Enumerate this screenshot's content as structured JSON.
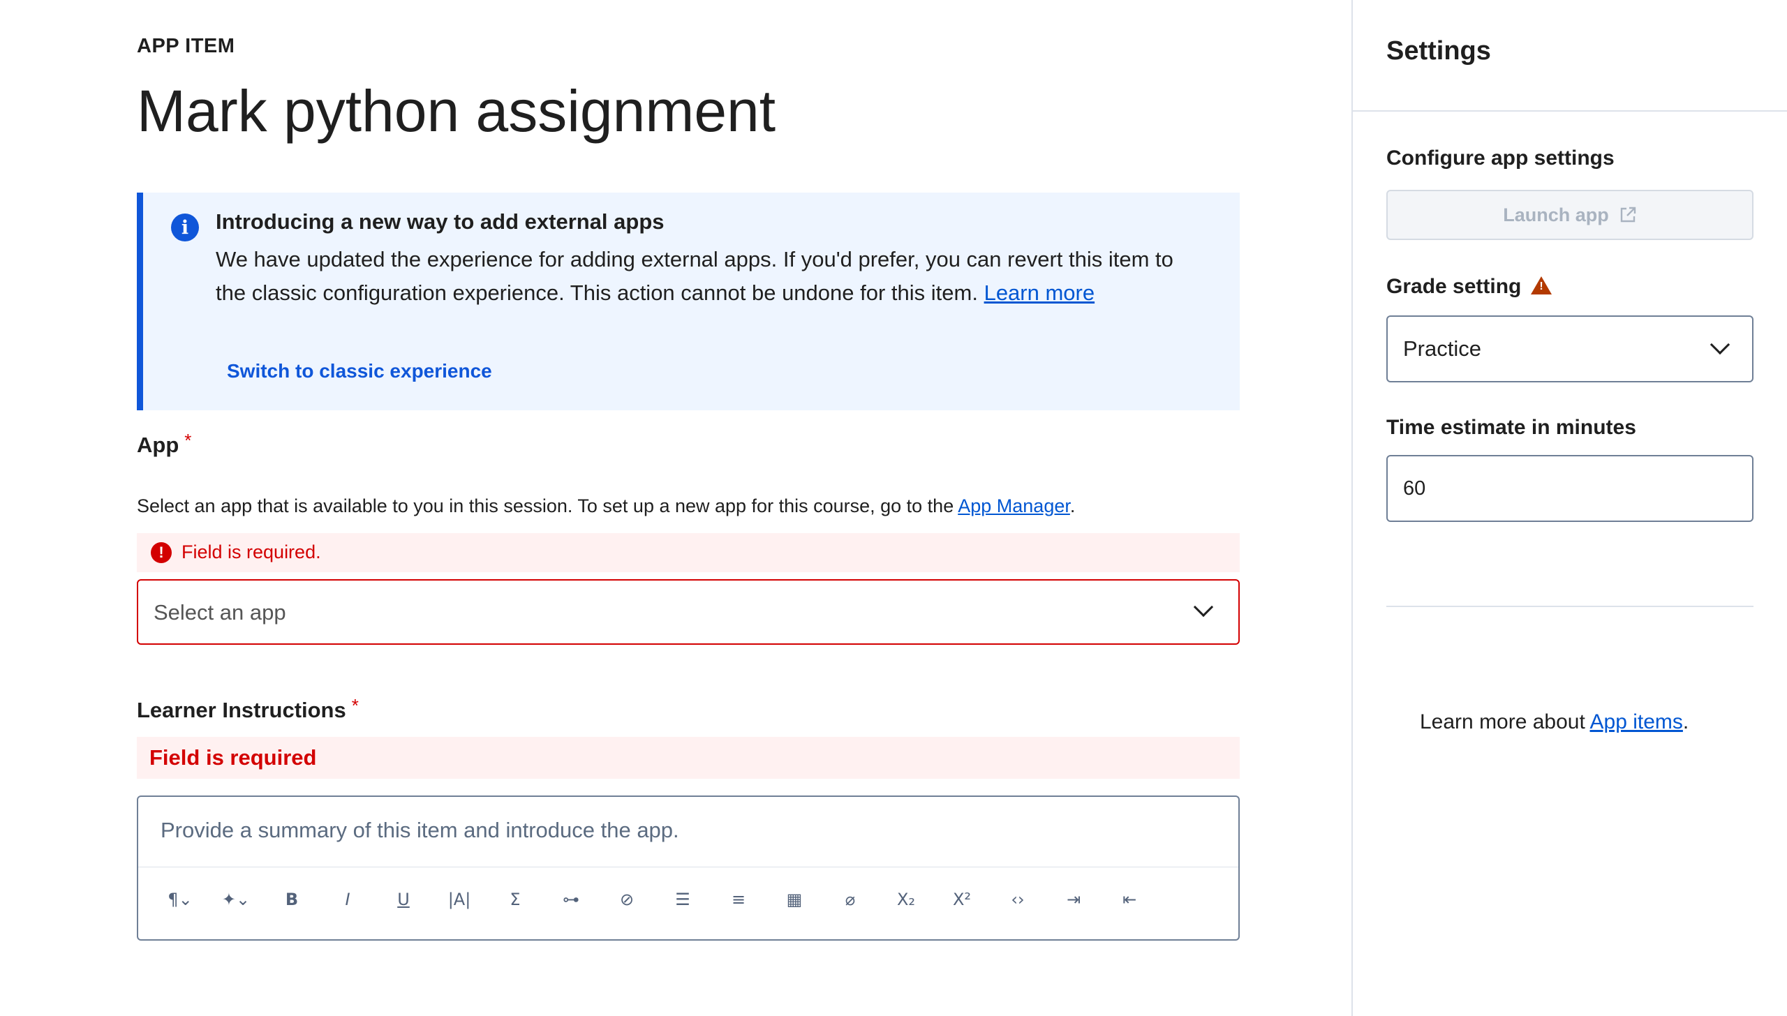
{
  "header": {
    "eyebrow": "APP ITEM",
    "title": "Mark python assignment"
  },
  "banner": {
    "title": "Introducing a new way to add external apps",
    "body": "We have updated the experience for adding external apps. If you'd prefer, you can revert this item to the classic configuration experience. This action cannot be undone for this item.",
    "learn_more": "Learn more",
    "switch_label": "Switch to classic experience"
  },
  "app_field": {
    "label": "App",
    "required_mark": "*",
    "helper_text": "Select an app that is available to you in this session. To set up a new app for this course, go to the",
    "helper_link": "App Manager",
    "helper_end": ".",
    "error": "Field is required.",
    "placeholder": "Select an app"
  },
  "instructions_field": {
    "label": "Learner Instructions",
    "required_mark": "*",
    "error": "Field is required",
    "placeholder": "Provide a summary of this item and introduce the app.",
    "toolbar": [
      {
        "name": "paragraph-format-icon",
        "glyph": "¶⌄"
      },
      {
        "name": "ai-sparkle-icon",
        "glyph": "✦⌄"
      },
      {
        "name": "bold-icon",
        "glyph": "B"
      },
      {
        "name": "italic-icon",
        "glyph": "I"
      },
      {
        "name": "underline-icon",
        "glyph": "U"
      },
      {
        "name": "text-size-icon",
        "glyph": "|A|"
      },
      {
        "name": "math-sigma-icon",
        "glyph": "Σ"
      },
      {
        "name": "link-icon",
        "glyph": "⊶"
      },
      {
        "name": "unlink-icon",
        "glyph": "⊘"
      },
      {
        "name": "bulleted-list-icon",
        "glyph": "☰"
      },
      {
        "name": "numbered-list-icon",
        "glyph": "≡"
      },
      {
        "name": "table-icon",
        "glyph": "▦"
      },
      {
        "name": "attachment-icon",
        "glyph": "⌀"
      },
      {
        "name": "subscript-icon",
        "glyph": "X₂"
      },
      {
        "name": "superscript-icon",
        "glyph": "X²"
      },
      {
        "name": "code-icon",
        "glyph": "‹›"
      },
      {
        "name": "indent-icon",
        "glyph": "⇥"
      },
      {
        "name": "outdent-icon",
        "glyph": "⇤"
      }
    ]
  },
  "sidebar": {
    "title": "Settings",
    "configure_label": "Configure app settings",
    "launch_label": "Launch app",
    "grade_label": "Grade setting",
    "grade_value": "Practice",
    "time_label": "Time estimate in minutes",
    "time_value": "60",
    "learn_more_prefix": "Learn more about",
    "learn_more_link": "App items",
    "learn_more_suffix": "."
  },
  "colors": {
    "accent": "#0f56d9",
    "error": "#d30001",
    "warning": "#b33a00",
    "banner_bg": "#eef5ff"
  }
}
